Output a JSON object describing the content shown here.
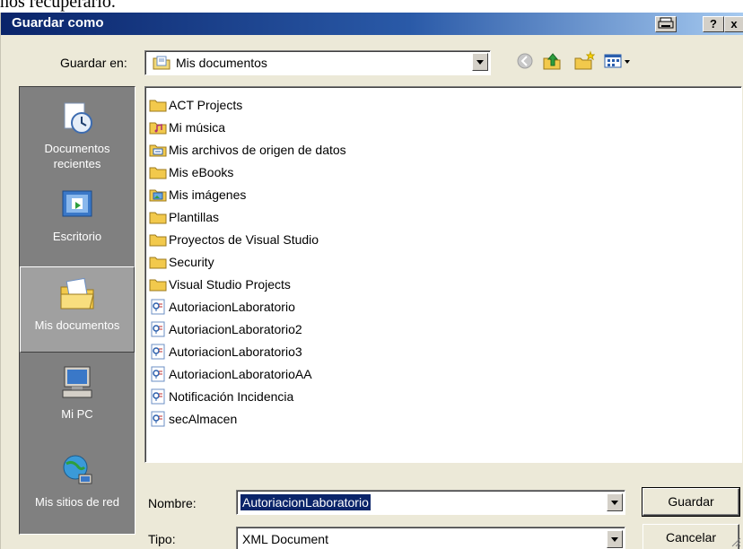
{
  "cropped_text": "nos recuperarlo.",
  "window": {
    "title": "Guardar como",
    "help_label": "?",
    "close_label": "x"
  },
  "lookin": {
    "label": "Guardar en:",
    "value": "Mis documentos",
    "icon": "my-documents-icon"
  },
  "toolbar": {
    "icons": [
      "back-icon",
      "up-folder-icon",
      "new-folder-icon",
      "views-menu-icon"
    ]
  },
  "places": [
    {
      "label": "Documentos recientes",
      "icon": "recent-documents-icon"
    },
    {
      "label": "Escritorio",
      "icon": "desktop-icon"
    },
    {
      "label": "Mis documentos",
      "icon": "my-documents-icon"
    },
    {
      "label": "Mi PC",
      "icon": "my-computer-icon"
    },
    {
      "label": "Mis sitios de red",
      "icon": "network-places-icon"
    }
  ],
  "files": [
    {
      "name": "ACT Projects",
      "icon": "folder-icon"
    },
    {
      "name": "Mi música",
      "icon": "music-folder-icon"
    },
    {
      "name": "Mis archivos de origen de datos",
      "icon": "data-sources-folder-icon"
    },
    {
      "name": "Mis eBooks",
      "icon": "folder-icon"
    },
    {
      "name": "Mis imágenes",
      "icon": "pictures-folder-icon"
    },
    {
      "name": "Plantillas",
      "icon": "folder-icon"
    },
    {
      "name": "Proyectos de Visual Studio",
      "icon": "folder-icon"
    },
    {
      "name": "Security",
      "icon": "folder-icon"
    },
    {
      "name": "Visual Studio Projects",
      "icon": "folder-icon"
    },
    {
      "name": "AutoriacionLaboratorio",
      "icon": "xml-file-icon"
    },
    {
      "name": "AutoriacionLaboratorio2",
      "icon": "xml-file-icon"
    },
    {
      "name": "AutoriacionLaboratorio3",
      "icon": "xml-file-icon"
    },
    {
      "name": "AutoriacionLaboratorioAA",
      "icon": "xml-file-icon"
    },
    {
      "name": "Notificación Incidencia",
      "icon": "xml-file-icon"
    },
    {
      "name": "secAlmacen",
      "icon": "xml-file-icon"
    }
  ],
  "filename": {
    "label": "Nombre:",
    "value": "AutoriacionLaboratorio"
  },
  "filetype": {
    "label": "Tipo:",
    "value": "XML Document"
  },
  "buttons": {
    "save": "Guardar",
    "cancel": "Cancelar"
  },
  "colors": {
    "titlebar_start": "#0a246a",
    "titlebar_end": "#a6caf0",
    "dialog_bg": "#ece9d8",
    "places_bg": "#808080",
    "selection": "#0a246a"
  }
}
